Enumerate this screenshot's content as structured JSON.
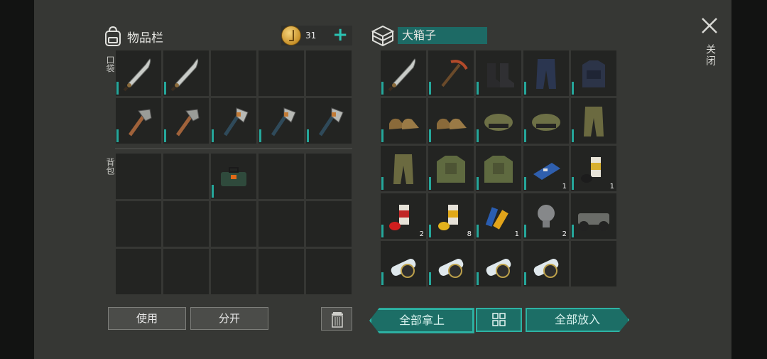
{
  "inventory": {
    "title": "物品栏",
    "coins": "31",
    "plus": "+",
    "pockets_label": "口袋",
    "backpack_label": "背包",
    "pockets": [
      {
        "item": "machete",
        "qty": ""
      },
      {
        "item": "machete",
        "qty": ""
      },
      {
        "item": "empty",
        "qty": ""
      },
      {
        "item": "empty",
        "qty": ""
      },
      {
        "item": "empty",
        "qty": ""
      },
      {
        "item": "pickaxe",
        "qty": ""
      },
      {
        "item": "pickaxe",
        "qty": ""
      },
      {
        "item": "hatchet",
        "qty": ""
      },
      {
        "item": "hatchet",
        "qty": ""
      },
      {
        "item": "hatchet",
        "qty": ""
      }
    ],
    "backpack": [
      {
        "item": "empty"
      },
      {
        "item": "empty"
      },
      {
        "item": "toolbox"
      },
      {
        "item": "empty"
      },
      {
        "item": "empty"
      },
      {
        "item": "empty"
      },
      {
        "item": "empty"
      },
      {
        "item": "empty"
      },
      {
        "item": "empty"
      },
      {
        "item": "empty"
      },
      {
        "item": "empty"
      },
      {
        "item": "empty"
      },
      {
        "item": "empty"
      },
      {
        "item": "empty"
      },
      {
        "item": "empty"
      }
    ]
  },
  "box": {
    "title": "大箱子",
    "items": [
      {
        "item": "machete",
        "qty": ""
      },
      {
        "item": "red-pickaxe",
        "qty": ""
      },
      {
        "item": "black-boots",
        "qty": ""
      },
      {
        "item": "tactical-pants",
        "qty": ""
      },
      {
        "item": "tactical-vest",
        "qty": ""
      },
      {
        "item": "leather-boots",
        "qty": ""
      },
      {
        "item": "leather-boots",
        "qty": ""
      },
      {
        "item": "camo-cap",
        "qty": ""
      },
      {
        "item": "camo-cap",
        "qty": ""
      },
      {
        "item": "camo-pants",
        "qty": ""
      },
      {
        "item": "camo-pants",
        "qty": ""
      },
      {
        "item": "camo-jacket",
        "qty": ""
      },
      {
        "item": "camo-jacket",
        "qty": ""
      },
      {
        "item": "circuit-board",
        "qty": "1"
      },
      {
        "item": "white-spray-can",
        "qty": "1"
      },
      {
        "item": "red-spray-can",
        "qty": "2"
      },
      {
        "item": "yellow-spray-can",
        "qty": "8"
      },
      {
        "item": "batteries",
        "qty": "1"
      },
      {
        "item": "light-bulb",
        "qty": "2"
      },
      {
        "item": "atv-vehicle",
        "qty": ""
      },
      {
        "item": "blueprint-roll",
        "qty": ""
      },
      {
        "item": "blueprint-roll",
        "qty": ""
      },
      {
        "item": "blueprint-roll",
        "qty": ""
      },
      {
        "item": "blueprint-roll",
        "qty": ""
      },
      {
        "item": "empty",
        "qty": ""
      }
    ]
  },
  "buttons": {
    "use": "使用",
    "split": "分开",
    "take_all": "全部拿上",
    "put_all": "全部放入",
    "close": "关闭"
  },
  "colors": {
    "accent": "#2db3a4",
    "panel": "#363734",
    "cell": "#232422"
  }
}
